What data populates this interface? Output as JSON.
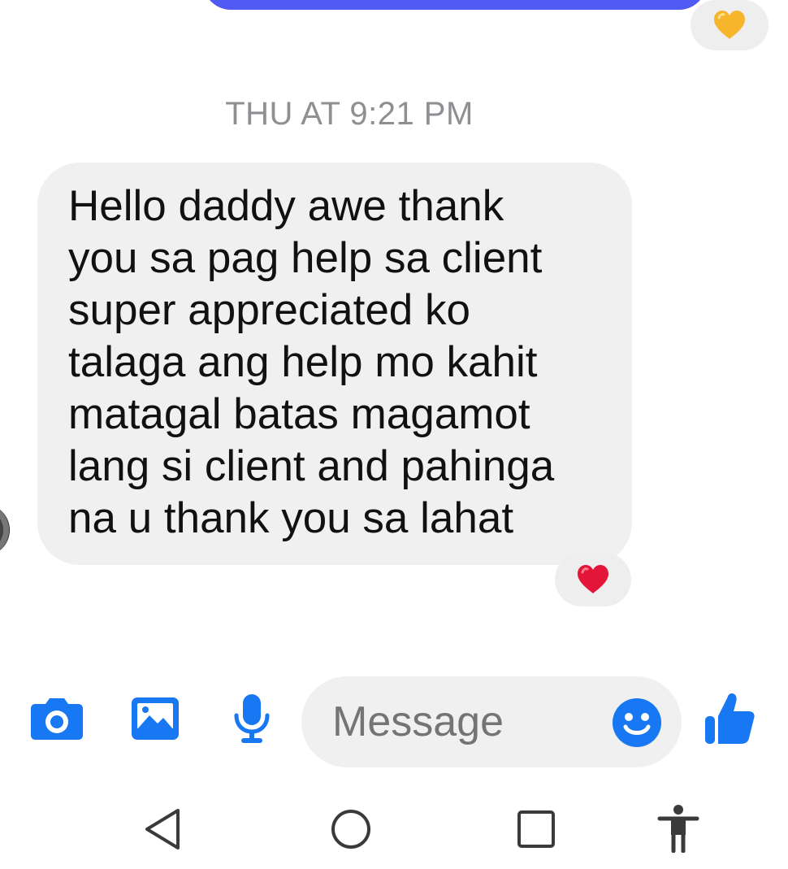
{
  "thread": {
    "timestamp": "THU AT 9:21 PM",
    "received_message": "Hello daddy awe thank\nyou sa pag help sa client\nsuper appreciated ko\ntalaga ang help mo kahit\nmatagal batas magamot\nlang si client and pahinga\nna u thank you sa lahat",
    "reactions": {
      "top": "yellow-heart-icon",
      "bottom": "red-heart-icon"
    }
  },
  "composer": {
    "placeholder": "Message",
    "icons": [
      "camera-icon",
      "image-icon",
      "microphone-icon",
      "emoji-icon",
      "thumbs-up-icon"
    ]
  },
  "navigation": {
    "icons": [
      "back-icon",
      "home-icon",
      "recents-icon",
      "accessibility-icon"
    ]
  },
  "colors": {
    "accent": "#1877f2",
    "sent_bubble": "#4f5bf2",
    "received_bubble": "#f0f0f0",
    "timestamp": "#8e8e93",
    "heart_red": "#e3163a",
    "heart_yellow": "#f7b52b"
  }
}
